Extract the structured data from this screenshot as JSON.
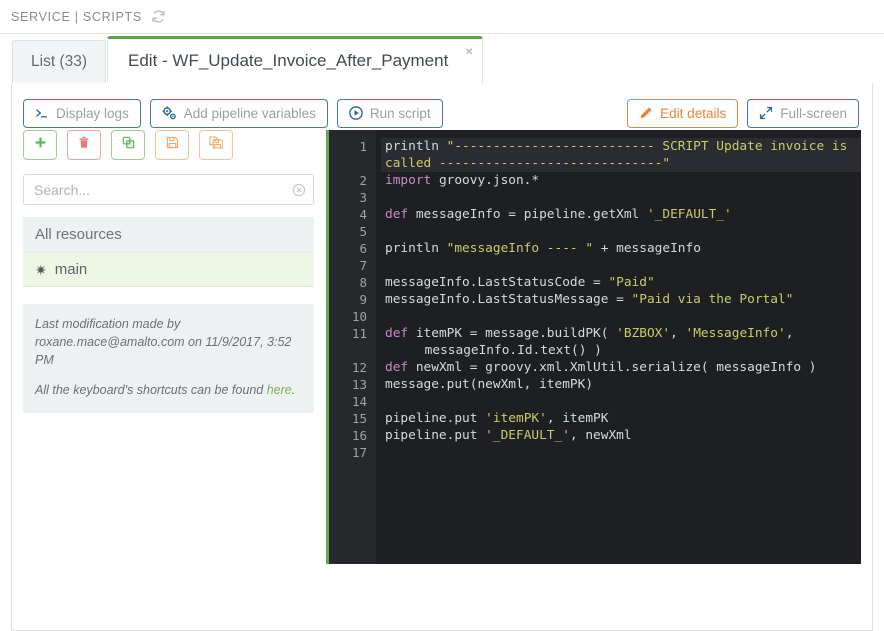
{
  "header": {
    "breadcrumb": "SERVICE | SCRIPTS",
    "refresh_icon": "refresh-icon"
  },
  "tabs": [
    {
      "label": "List (33)",
      "active": false
    },
    {
      "label": "Edit - WF_Update_Invoice_After_Payment",
      "active": true,
      "close": "×"
    }
  ],
  "toolbar": {
    "display_logs": "Display logs",
    "add_pipeline_variables": "Add pipeline variables",
    "run_script": "Run script",
    "edit_details": "Edit details",
    "full_screen": "Full-screen",
    "icons": {
      "display_logs": "terminal-icon",
      "add_pipeline_variables": "gears-icon",
      "run_script": "play-circle-icon",
      "edit_details": "pencil-icon",
      "full_screen": "expand-arrows-icon"
    }
  },
  "resource_actions": [
    {
      "name": "add-resource-button",
      "icon": "plus-icon",
      "color": "#5cb85c"
    },
    {
      "name": "delete-resource-button",
      "icon": "trash-icon",
      "color": "#e27b7b"
    },
    {
      "name": "duplicate-resource-button",
      "icon": "copy-icon",
      "color": "#5cb85c"
    },
    {
      "name": "save-resource-button",
      "icon": "floppy-disk-icon",
      "color": "#efa868"
    },
    {
      "name": "save-all-resources-button",
      "icon": "save-all-icon",
      "color": "#efa868"
    }
  ],
  "search": {
    "placeholder": "Search...",
    "value": "",
    "clear_icon": "clear-circle-icon"
  },
  "resources": {
    "header": "All resources",
    "items": [
      {
        "label": "main",
        "icon": "star-icon",
        "selected": true
      }
    ]
  },
  "info": {
    "line1": "Last modification made by",
    "line2": "roxane.mace@amalto.com on 11/9/2017, 3:52 PM",
    "shortcuts_prefix": "All the keyboard's shortcuts can be found ",
    "shortcuts_link": "here",
    "shortcuts_suffix": "."
  },
  "editor": {
    "line_numbers": [
      "1",
      "2",
      "3",
      "4",
      "5",
      "6",
      "7",
      "8",
      "9",
      "10",
      "11",
      "12",
      "13",
      "14",
      "15",
      "16",
      "17"
    ],
    "lines": [
      {
        "n": 1,
        "wrapped": true,
        "highlight": true,
        "text": "println \"-------------------------- SCRIPT Update invoice is called -----------------------------\""
      },
      {
        "n": 2,
        "text": "import groovy.json.*"
      },
      {
        "n": 3,
        "text": ""
      },
      {
        "n": 4,
        "text": "def messageInfo = pipeline.getXml '_DEFAULT_'"
      },
      {
        "n": 5,
        "text": ""
      },
      {
        "n": 6,
        "text": "println \"messageInfo ---- \" + messageInfo"
      },
      {
        "n": 7,
        "text": ""
      },
      {
        "n": 8,
        "text": "messageInfo.LastStatusCode = \"Paid\""
      },
      {
        "n": 9,
        "text": "messageInfo.LastStatusMessage = \"Paid via the Portal\""
      },
      {
        "n": 10,
        "text": ""
      },
      {
        "n": 11,
        "wrapped": true,
        "text": "def itemPK = message.buildPK( 'BZBOX', 'MessageInfo', messageInfo.Id.text() )"
      },
      {
        "n": 12,
        "text": "def newXml = groovy.xml.XmlUtil.serialize( messageInfo )"
      },
      {
        "n": 13,
        "text": "message.put(newXml, itemPK)"
      },
      {
        "n": 14,
        "text": ""
      },
      {
        "n": 15,
        "text": "pipeline.put 'itemPK', itemPK"
      },
      {
        "n": 16,
        "text": "pipeline.put '_DEFAULT_', newXml"
      },
      {
        "n": 17,
        "text": ""
      }
    ],
    "colors": {
      "background": "#1e1f22",
      "gutter": "#26282c",
      "left_accent": "#6aa84f",
      "keyword": "#c98bc4",
      "string": "#c9cc6a",
      "plain": "#d6d9dc",
      "line_number": "#9da3a8"
    }
  },
  "theme": {
    "tab_active_accent": "#5aa545",
    "blue_outline": "#3f7fa5",
    "orange_outline": "#e8853b",
    "link_green": "#7cb354"
  }
}
